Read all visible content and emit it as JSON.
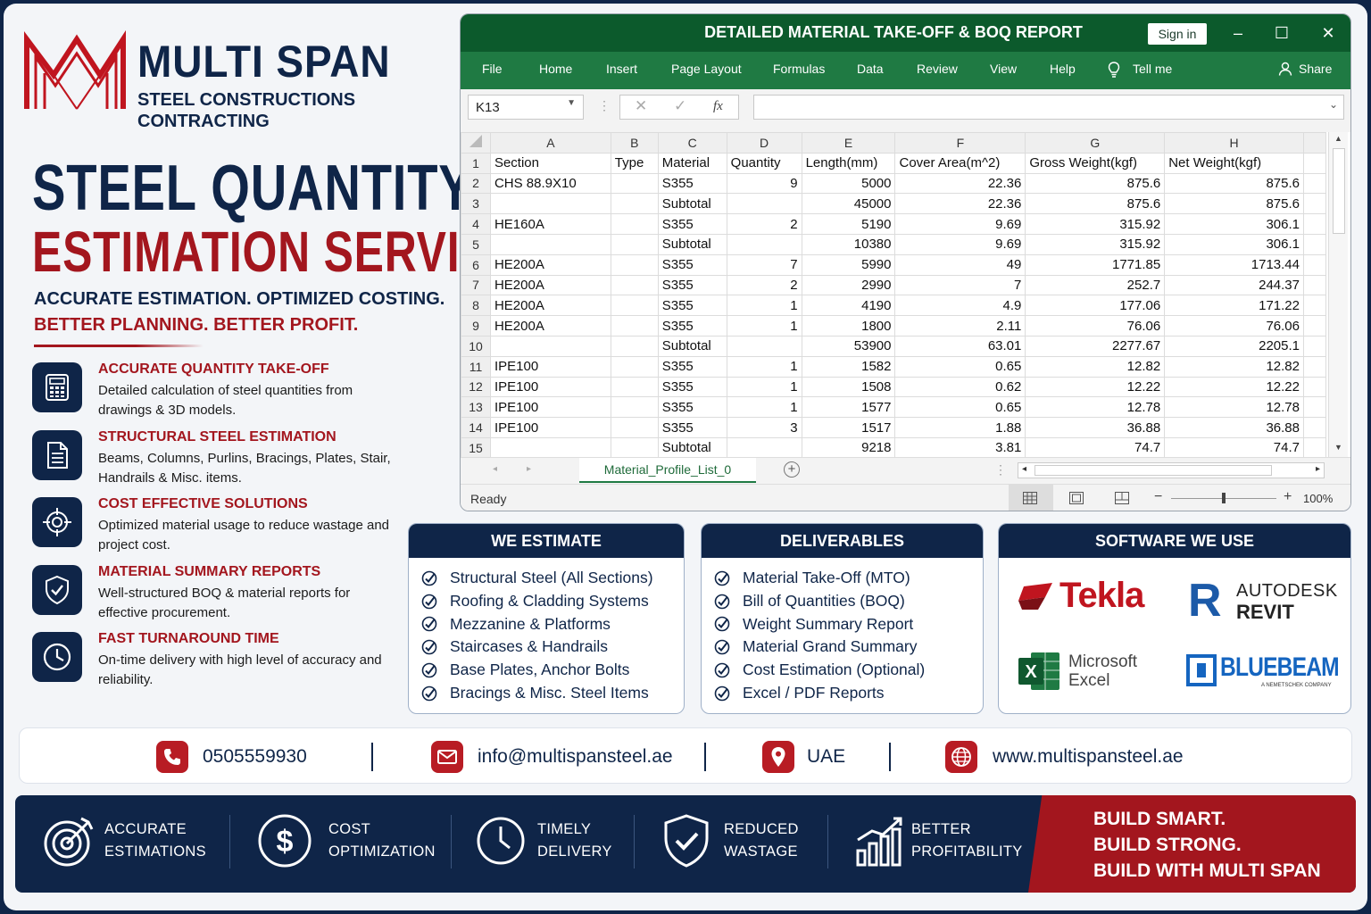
{
  "brand": {
    "name": "MULTI SPAN",
    "sub1": "STEEL CONSTRUCTIONS",
    "sub2": "CONTRACTING"
  },
  "hero": {
    "line1": "STEEL QUANTITY",
    "line2": "ESTIMATION SERVICES",
    "tagline1": "ACCURATE ESTIMATION. OPTIMIZED COSTING.",
    "tagline2": "BETTER PLANNING. BETTER PROFIT."
  },
  "features": [
    {
      "icon": "calculator-icon",
      "title": "ACCURATE QUANTITY TAKE-OFF",
      "desc": "Detailed calculation of steel quantities from drawings & 3D models."
    },
    {
      "icon": "document-icon",
      "title": "STRUCTURAL STEEL ESTIMATION",
      "desc": "Beams, Columns, Purlins, Bracings, Plates, Stair, Handrails & Misc. items."
    },
    {
      "icon": "target-icon",
      "title": "COST EFFECTIVE SOLUTIONS",
      "desc": "Optimized material usage to reduce wastage and project cost."
    },
    {
      "icon": "shield-check-icon",
      "title": "MATERIAL SUMMARY REPORTS",
      "desc": "Well-structured BOQ & material reports for effective procurement."
    },
    {
      "icon": "clock-icon",
      "title": "FAST TURNAROUND TIME",
      "desc": "On-time delivery with high level of accuracy and reliability."
    }
  ],
  "excel": {
    "title": "DETAILED MATERIAL TAKE-OFF & BOQ REPORT",
    "signin": "Sign in",
    "ribbon": [
      "File",
      "Home",
      "Insert",
      "Page Layout",
      "Formulas",
      "Data",
      "Review",
      "View",
      "Help"
    ],
    "tellme": "Tell me",
    "share": "Share",
    "namebox": "K13",
    "fx": "fx",
    "columns": [
      "A",
      "B",
      "C",
      "D",
      "E",
      "F",
      "G",
      "H"
    ],
    "header_row": [
      "Section",
      "Type",
      "Material",
      "Quantity",
      "Length(mm)",
      "Cover Area(m^2)",
      "Gross Weight(kgf)",
      "Net Weight(kgf)"
    ],
    "rows": [
      [
        "CHS 88.9X10",
        "",
        "S355",
        "9",
        "5000",
        "22.36",
        "875.6",
        "875.6"
      ],
      [
        "",
        "",
        "Subtotal",
        "",
        "45000",
        "22.36",
        "875.6",
        "875.6"
      ],
      [
        "HE160A",
        "",
        "S355",
        "2",
        "5190",
        "9.69",
        "315.92",
        "306.1"
      ],
      [
        "",
        "",
        "Subtotal",
        "",
        "10380",
        "9.69",
        "315.92",
        "306.1"
      ],
      [
        "HE200A",
        "",
        "S355",
        "7",
        "5990",
        "49",
        "1771.85",
        "1713.44"
      ],
      [
        "HE200A",
        "",
        "S355",
        "2",
        "2990",
        "7",
        "252.7",
        "244.37"
      ],
      [
        "HE200A",
        "",
        "S355",
        "1",
        "4190",
        "4.9",
        "177.06",
        "171.22"
      ],
      [
        "HE200A",
        "",
        "S355",
        "1",
        "1800",
        "2.11",
        "76.06",
        "76.06"
      ],
      [
        "",
        "",
        "Subtotal",
        "",
        "53900",
        "63.01",
        "2277.67",
        "2205.1"
      ],
      [
        "IPE100",
        "",
        "S355",
        "1",
        "1582",
        "0.65",
        "12.82",
        "12.82"
      ],
      [
        "IPE100",
        "",
        "S355",
        "1",
        "1508",
        "0.62",
        "12.22",
        "12.22"
      ],
      [
        "IPE100",
        "",
        "S355",
        "1",
        "1577",
        "0.65",
        "12.78",
        "12.78"
      ],
      [
        "IPE100",
        "",
        "S355",
        "3",
        "1517",
        "1.88",
        "36.88",
        "36.88"
      ],
      [
        "",
        "",
        "Subtotal",
        "",
        "9218",
        "3.81",
        "74.7",
        "74.7"
      ]
    ],
    "sheet_tab": "Material_Profile_List_0",
    "status": "Ready",
    "zoom": "100%"
  },
  "we_estimate": {
    "title": "WE ESTIMATE",
    "items": [
      "Structural Steel (All Sections)",
      "Roofing & Cladding Systems",
      "Mezzanine & Platforms",
      "Staircases & Handrails",
      "Base Plates, Anchor Bolts",
      "Bracings & Misc. Steel Items"
    ]
  },
  "deliverables": {
    "title": "DELIVERABLES",
    "items": [
      "Material Take-Off (MTO)",
      "Bill of Quantities (BOQ)",
      "Weight Summary Report",
      "Material Grand Summary",
      "Cost Estimation (Optional)",
      "Excel / PDF Reports"
    ]
  },
  "software": {
    "title": "SOFTWARE WE USE",
    "tekla": "Tekla",
    "revit1": "AUTODESK",
    "revit2": "REVIT",
    "excel1": "Microsoft",
    "excel2": "Excel",
    "bluebeam": "BLUEBEAM",
    "bluebeam_sub": "A NEMETSCHEK COMPANY"
  },
  "contact": {
    "phone": "0505559930",
    "email": "info@multispansteel.ae",
    "location": "UAE",
    "website": "www.multispansteel.ae"
  },
  "benefits": [
    {
      "icon": "target-arrow-icon",
      "l1": "ACCURATE",
      "l2": "ESTIMATIONS"
    },
    {
      "icon": "dollar-icon",
      "l1": "COST",
      "l2": "OPTIMIZATION"
    },
    {
      "icon": "clock-icon",
      "l1": "TIMELY",
      "l2": "DELIVERY"
    },
    {
      "icon": "shield-check-icon",
      "l1": "REDUCED",
      "l2": "WASTAGE"
    },
    {
      "icon": "growth-chart-icon",
      "l1": "BETTER",
      "l2": "PROFITABILITY"
    }
  ],
  "slogan": {
    "l1": "BUILD SMART.",
    "l2": "BUILD STRONG.",
    "l3": "BUILD WITH MULTI SPAN"
  },
  "colors": {
    "navy": "#0f2548",
    "red": "#a3161e",
    "excel_green": "#1f7a43"
  }
}
